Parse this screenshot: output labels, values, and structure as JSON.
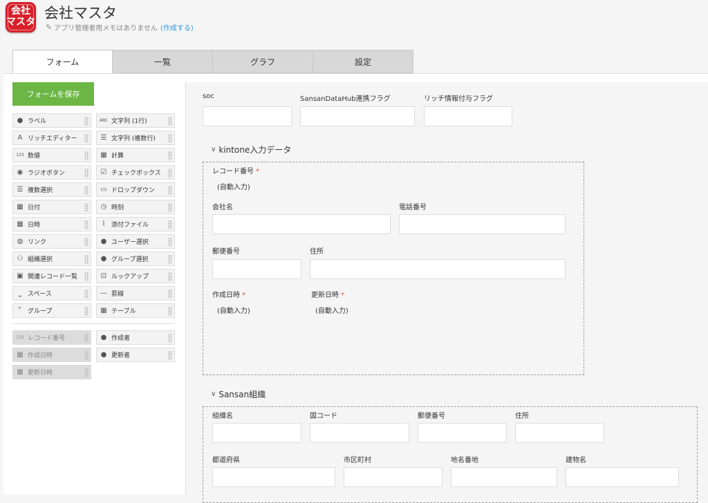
{
  "app": {
    "icon_text_1": "会社",
    "icon_text_2": "マスタ",
    "title": "会社マスタ",
    "memo": "アプリ管理者用メモはありません",
    "memo_link": "(作成する)"
  },
  "tabs": [
    "フォーム",
    "一覧",
    "グラフ",
    "設定"
  ],
  "save_label": "フォームを保存",
  "palette": [
    {
      "icon": "tag-icon",
      "glyph": "●",
      "label": "ラベル"
    },
    {
      "icon": "text-single-icon",
      "glyph": "ABC",
      "label": "文字列 (1行)"
    },
    {
      "icon": "rich-editor-icon",
      "glyph": "A",
      "label": "リッチエディター"
    },
    {
      "icon": "text-multi-icon",
      "glyph": "☰",
      "label": "文字列 (複数行)"
    },
    {
      "icon": "number-icon",
      "glyph": "123",
      "label": "数値"
    },
    {
      "icon": "calc-icon",
      "glyph": "▦",
      "label": "計算"
    },
    {
      "icon": "radio-icon",
      "glyph": "◉",
      "label": "ラジオボタン"
    },
    {
      "icon": "checkbox-icon",
      "glyph": "☑",
      "label": "チェックボックス"
    },
    {
      "icon": "multi-select-icon",
      "glyph": "☰",
      "label": "複数選択"
    },
    {
      "icon": "dropdown-icon",
      "glyph": "▭",
      "label": "ドロップダウン"
    },
    {
      "icon": "date-icon",
      "glyph": "▦",
      "label": "日付"
    },
    {
      "icon": "clock-icon",
      "glyph": "◷",
      "label": "時刻"
    },
    {
      "icon": "datetime-icon",
      "glyph": "▦",
      "label": "日時"
    },
    {
      "icon": "attachment-icon",
      "glyph": "⌇",
      "label": "添付ファイル"
    },
    {
      "icon": "link-icon",
      "glyph": "◍",
      "label": "リンク"
    },
    {
      "icon": "user-icon",
      "glyph": "●",
      "label": "ユーザー選択"
    },
    {
      "icon": "org-icon",
      "glyph": "⚇",
      "label": "組織選択"
    },
    {
      "icon": "group-user-icon",
      "glyph": "●",
      "label": "グループ選択"
    },
    {
      "icon": "related-records-icon",
      "glyph": "▣",
      "label": "関連レコード一覧"
    },
    {
      "icon": "lookup-icon",
      "glyph": "⊡",
      "label": "ルックアップ"
    },
    {
      "icon": "space-icon",
      "glyph": "⎵",
      "label": "スペース"
    },
    {
      "icon": "line-icon",
      "glyph": "—",
      "label": "罫線"
    },
    {
      "icon": "group-icon",
      "glyph": "⌜",
      "label": "グループ"
    },
    {
      "icon": "table-icon",
      "glyph": "▦",
      "label": "テーブル"
    }
  ],
  "palette2": [
    {
      "icon": "number-icon",
      "glyph": "123",
      "label": "レコード番号",
      "disabled": true
    },
    {
      "icon": "user-icon",
      "glyph": "●",
      "label": "作成者",
      "disabled": false
    },
    {
      "icon": "datetime-icon",
      "glyph": "▦",
      "label": "作成日時",
      "disabled": true
    },
    {
      "icon": "user-icon",
      "glyph": "●",
      "label": "更新者",
      "disabled": false
    },
    {
      "icon": "datetime-icon",
      "glyph": "▦",
      "label": "更新日時",
      "disabled": true
    }
  ],
  "form": {
    "top_fields": [
      "soc",
      "SansanDataHub連携フラグ",
      "リッチ情報付与フラグ"
    ],
    "group1": {
      "title": "kintone入力データ",
      "record_no": "レコード番号",
      "auto": "(自動入力)",
      "company": "会社名",
      "phone": "電話番号",
      "postal": "郵便番号",
      "address": "住所",
      "created": "作成日時",
      "updated": "更新日時",
      "req_mark": "*"
    },
    "group2": {
      "title": "Sansan組織",
      "fields_row1": [
        "組織名",
        "国コード",
        "郵便番号",
        "住所"
      ],
      "fields_row2": [
        "都道府県",
        "市区町村",
        "地名番地",
        "建物名"
      ]
    }
  }
}
